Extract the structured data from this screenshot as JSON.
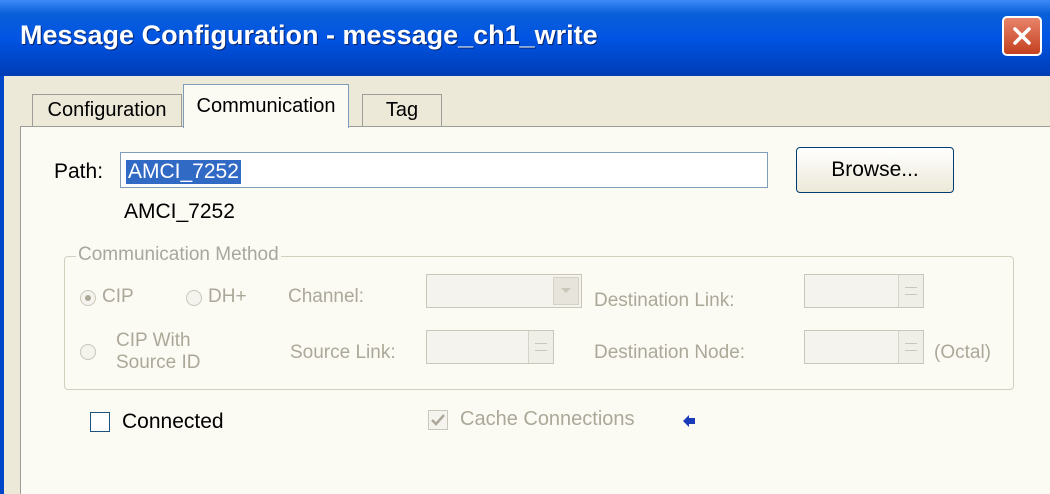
{
  "window": {
    "title": "Message Configuration - message_ch1_write"
  },
  "tabs": [
    {
      "label": "Configuration",
      "active": false
    },
    {
      "label": "Communication",
      "active": true
    },
    {
      "label": "Tag",
      "active": false
    }
  ],
  "path": {
    "label": "Path:",
    "value": "AMCI_7252",
    "resolved": "AMCI_7252",
    "browse_label": "Browse..."
  },
  "comm_method": {
    "title": "Communication Method",
    "options": {
      "cip": "CIP",
      "dh_plus": "DH+",
      "cip_source_line1": "CIP With",
      "cip_source_line2": "Source ID"
    },
    "selected": "CIP",
    "channel_label": "Channel:",
    "destination_link_label": "Destination Link:",
    "source_link_label": "Source Link:",
    "destination_node_label": "Destination Node:",
    "octal_label": "(Octal)"
  },
  "options": {
    "connected_label": "Connected",
    "connected_checked": false,
    "cache_label": "Cache Connections",
    "cache_checked": true
  },
  "icons": {
    "close": "close-icon",
    "arrow": "arrow-left-icon",
    "check": "check-icon"
  }
}
